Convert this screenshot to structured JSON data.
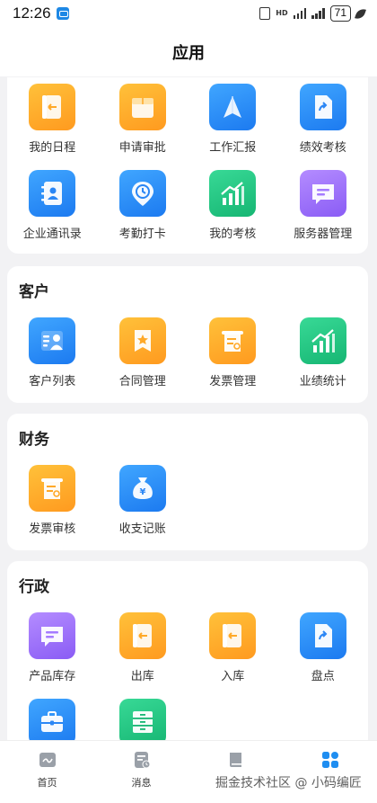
{
  "status_bar": {
    "time": "12:26",
    "battery": "71"
  },
  "header": {
    "title": "应用"
  },
  "sections": {
    "top": {
      "items": [
        "我的日程",
        "申请审批",
        "工作汇报",
        "绩效考核",
        "企业通讯录",
        "考勤打卡",
        "我的考核",
        "服务器管理"
      ]
    },
    "customer": {
      "title": "客户",
      "items": [
        "客户列表",
        "合同管理",
        "发票管理",
        "业绩统计"
      ]
    },
    "finance": {
      "title": "财务",
      "items": [
        "发票审核",
        "收支记账"
      ]
    },
    "admin": {
      "title": "行政",
      "items": [
        "产品库存",
        "出库",
        "入库",
        "盘点",
        "",
        ""
      ]
    }
  },
  "tabbar": {
    "items": [
      "首页",
      "消息",
      "",
      ""
    ]
  },
  "watermark": "掘金技术社区 @ 小码编匠",
  "colors": {
    "orange": "#ff9a1f",
    "blue": "#1c7af0",
    "green": "#16b673",
    "purple": "#8a5cf5"
  },
  "icons": {
    "top": [
      "calendar-book-icon",
      "approval-box-icon",
      "paper-plane-icon",
      "document-share-icon",
      "contact-book-icon",
      "clock-location-icon",
      "growth-chart-icon",
      "chat-bubble-icon"
    ],
    "customer": [
      "customer-list-icon",
      "contract-icon",
      "invoice-icon",
      "growth-chart-icon"
    ],
    "finance": [
      "invoice-review-icon",
      "money-bag-icon"
    ],
    "admin": [
      "chat-bubble-icon",
      "stock-out-icon",
      "stock-in-icon",
      "document-share-icon",
      "briefcase-icon",
      "cabinet-icon"
    ]
  }
}
